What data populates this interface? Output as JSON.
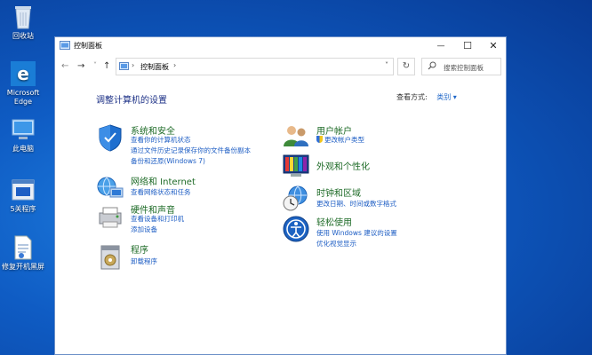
{
  "desktop": {
    "icons": [
      {
        "label": "回收站",
        "icon": "recycle-bin-icon"
      },
      {
        "label": "Microsoft Edge",
        "icon": "edge-icon"
      },
      {
        "label": "此电脑",
        "icon": "computer-icon"
      },
      {
        "label": "5关程序",
        "icon": "shutdown-program-icon"
      },
      {
        "label": "修复开机黑屏",
        "icon": "repair-script-icon"
      }
    ]
  },
  "window": {
    "title": "控制面板",
    "buttons": {
      "minimize": "—",
      "maximize": "☐",
      "close": "✕"
    },
    "address": {
      "back": "←",
      "forward": "→",
      "recent": "˅",
      "up": "↑",
      "separator": "›",
      "crumb": "控制面板",
      "dropdown": "˅",
      "refresh": "↻",
      "search_placeholder": "搜索控制面板"
    },
    "heading": "调整计算机的设置",
    "view_by": {
      "label": "查看方式:",
      "value": "类别 ▾"
    },
    "categories_left": [
      {
        "title": "系统和安全",
        "icon": "system-security-icon",
        "links": [
          "查看你的计算机状态",
          "通过文件历史记录保存你的文件备份副本",
          "备份和还原(Windows 7)"
        ]
      },
      {
        "title": "网络和 Internet",
        "icon": "network-internet-icon",
        "links": [
          "查看网络状态和任务"
        ]
      },
      {
        "title": "硬件和声音",
        "icon": "hardware-sound-icon",
        "links": [
          "查看设备和打印机",
          "添加设备"
        ]
      },
      {
        "title": "程序",
        "icon": "programs-icon",
        "links": [
          "卸载程序"
        ]
      }
    ],
    "categories_right": [
      {
        "title": "用户帐户",
        "icon": "user-accounts-icon",
        "links": [
          "更改帐户类型"
        ]
      },
      {
        "title": "外观和个性化",
        "icon": "appearance-icon",
        "links": []
      },
      {
        "title": "时钟和区域",
        "icon": "clock-region-icon",
        "links": [
          "更改日期、时间或数字格式"
        ]
      },
      {
        "title": "轻松使用",
        "icon": "ease-of-access-icon",
        "links": [
          "使用 Windows 建议的设置",
          "优化视觉显示"
        ]
      }
    ]
  }
}
